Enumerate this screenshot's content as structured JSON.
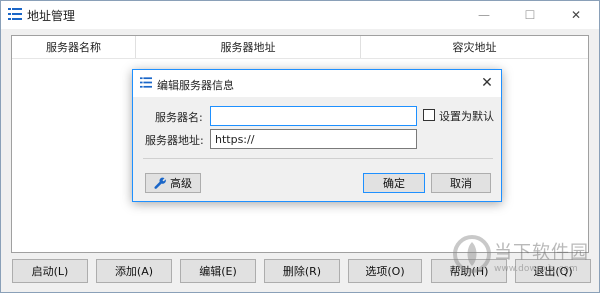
{
  "window": {
    "title": "地址管理",
    "min_glyph": "—",
    "max_glyph": "☐",
    "close_glyph": "✕"
  },
  "table": {
    "columns": [
      "服务器名称",
      "服务器地址",
      "容灾地址"
    ]
  },
  "bottom_buttons": [
    "启动(L)",
    "添加(A)",
    "编辑(E)",
    "删除(R)",
    "选项(O)",
    "帮助(H)",
    "退出(Q)"
  ],
  "dialog": {
    "title": "编辑服务器信息",
    "close_glyph": "✕",
    "name_label": "服务器名:",
    "name_value": "",
    "addr_label": "服务器地址:",
    "addr_value": "https://",
    "default_label": "设置为默认",
    "advanced_label": "高级",
    "ok_label": "确定",
    "cancel_label": "取消"
  },
  "watermark": {
    "name": "当下软件园",
    "url": "www.downxia.com"
  },
  "colors": {
    "accent": "#1e90ff",
    "icon_blue": "#1a66c8"
  }
}
